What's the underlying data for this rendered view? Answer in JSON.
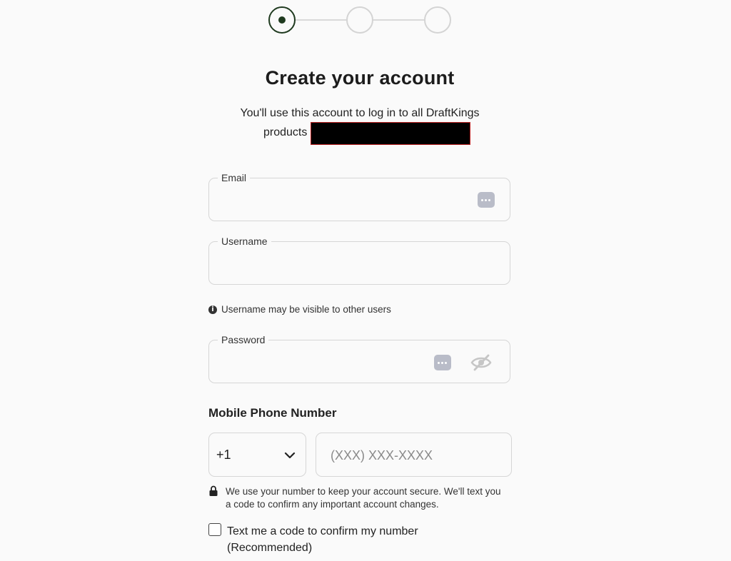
{
  "stepper": {
    "steps": 3,
    "current_step": 1
  },
  "header": {
    "title": "Create your account",
    "subtitle_line1": "You'll use this account to log in to all DraftKings",
    "subtitle_line2": "products"
  },
  "form": {
    "email": {
      "label": "Email",
      "value": ""
    },
    "username": {
      "label": "Username",
      "value": "",
      "hint": "Username may be visible to other users"
    },
    "password": {
      "label": "Password",
      "value": ""
    },
    "phone": {
      "section_title": "Mobile Phone Number",
      "country_code": "+1",
      "placeholder": "(XXX) XXX-XXXX",
      "secure_note": "We use your number to keep your account secure. We'll text you a code to confirm any important account changes.",
      "checkbox_label": "Text me a code to confirm my number (Recommended)",
      "checkbox_checked": false
    }
  },
  "colors": {
    "background": "#fafafa",
    "active_step": "#1f3a1f",
    "inactive_step": "#d4d4d4",
    "field_border": "#d6d6d6",
    "keyboard_icon": "#b9bcc8"
  }
}
